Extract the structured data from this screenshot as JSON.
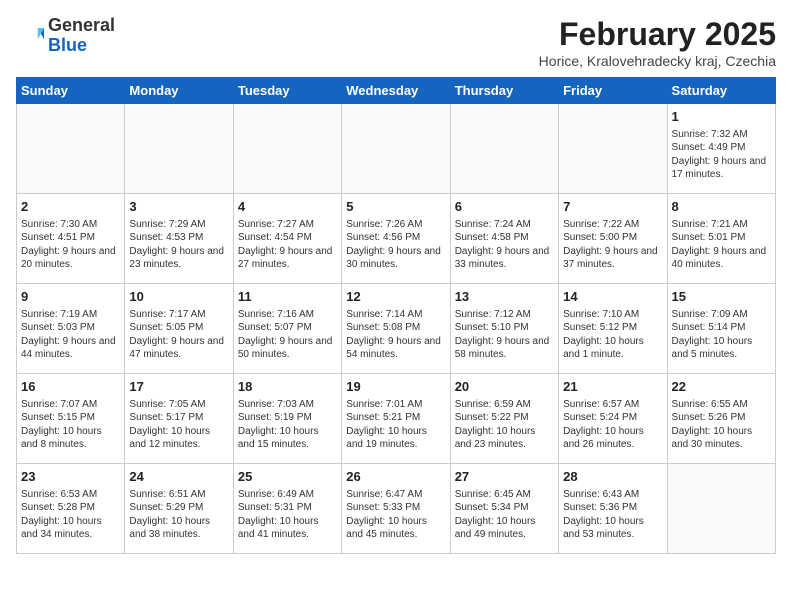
{
  "header": {
    "logo_general": "General",
    "logo_blue": "Blue",
    "title": "February 2025",
    "subtitle": "Horice, Kralovehradecky kraj, Czechia"
  },
  "weekdays": [
    "Sunday",
    "Monday",
    "Tuesday",
    "Wednesday",
    "Thursday",
    "Friday",
    "Saturday"
  ],
  "weeks": [
    [
      {
        "day": "",
        "info": ""
      },
      {
        "day": "",
        "info": ""
      },
      {
        "day": "",
        "info": ""
      },
      {
        "day": "",
        "info": ""
      },
      {
        "day": "",
        "info": ""
      },
      {
        "day": "",
        "info": ""
      },
      {
        "day": "1",
        "info": "Sunrise: 7:32 AM\nSunset: 4:49 PM\nDaylight: 9 hours and 17 minutes."
      }
    ],
    [
      {
        "day": "2",
        "info": "Sunrise: 7:30 AM\nSunset: 4:51 PM\nDaylight: 9 hours and 20 minutes."
      },
      {
        "day": "3",
        "info": "Sunrise: 7:29 AM\nSunset: 4:53 PM\nDaylight: 9 hours and 23 minutes."
      },
      {
        "day": "4",
        "info": "Sunrise: 7:27 AM\nSunset: 4:54 PM\nDaylight: 9 hours and 27 minutes."
      },
      {
        "day": "5",
        "info": "Sunrise: 7:26 AM\nSunset: 4:56 PM\nDaylight: 9 hours and 30 minutes."
      },
      {
        "day": "6",
        "info": "Sunrise: 7:24 AM\nSunset: 4:58 PM\nDaylight: 9 hours and 33 minutes."
      },
      {
        "day": "7",
        "info": "Sunrise: 7:22 AM\nSunset: 5:00 PM\nDaylight: 9 hours and 37 minutes."
      },
      {
        "day": "8",
        "info": "Sunrise: 7:21 AM\nSunset: 5:01 PM\nDaylight: 9 hours and 40 minutes."
      }
    ],
    [
      {
        "day": "9",
        "info": "Sunrise: 7:19 AM\nSunset: 5:03 PM\nDaylight: 9 hours and 44 minutes."
      },
      {
        "day": "10",
        "info": "Sunrise: 7:17 AM\nSunset: 5:05 PM\nDaylight: 9 hours and 47 minutes."
      },
      {
        "day": "11",
        "info": "Sunrise: 7:16 AM\nSunset: 5:07 PM\nDaylight: 9 hours and 50 minutes."
      },
      {
        "day": "12",
        "info": "Sunrise: 7:14 AM\nSunset: 5:08 PM\nDaylight: 9 hours and 54 minutes."
      },
      {
        "day": "13",
        "info": "Sunrise: 7:12 AM\nSunset: 5:10 PM\nDaylight: 9 hours and 58 minutes."
      },
      {
        "day": "14",
        "info": "Sunrise: 7:10 AM\nSunset: 5:12 PM\nDaylight: 10 hours and 1 minute."
      },
      {
        "day": "15",
        "info": "Sunrise: 7:09 AM\nSunset: 5:14 PM\nDaylight: 10 hours and 5 minutes."
      }
    ],
    [
      {
        "day": "16",
        "info": "Sunrise: 7:07 AM\nSunset: 5:15 PM\nDaylight: 10 hours and 8 minutes."
      },
      {
        "day": "17",
        "info": "Sunrise: 7:05 AM\nSunset: 5:17 PM\nDaylight: 10 hours and 12 minutes."
      },
      {
        "day": "18",
        "info": "Sunrise: 7:03 AM\nSunset: 5:19 PM\nDaylight: 10 hours and 15 minutes."
      },
      {
        "day": "19",
        "info": "Sunrise: 7:01 AM\nSunset: 5:21 PM\nDaylight: 10 hours and 19 minutes."
      },
      {
        "day": "20",
        "info": "Sunrise: 6:59 AM\nSunset: 5:22 PM\nDaylight: 10 hours and 23 minutes."
      },
      {
        "day": "21",
        "info": "Sunrise: 6:57 AM\nSunset: 5:24 PM\nDaylight: 10 hours and 26 minutes."
      },
      {
        "day": "22",
        "info": "Sunrise: 6:55 AM\nSunset: 5:26 PM\nDaylight: 10 hours and 30 minutes."
      }
    ],
    [
      {
        "day": "23",
        "info": "Sunrise: 6:53 AM\nSunset: 5:28 PM\nDaylight: 10 hours and 34 minutes."
      },
      {
        "day": "24",
        "info": "Sunrise: 6:51 AM\nSunset: 5:29 PM\nDaylight: 10 hours and 38 minutes."
      },
      {
        "day": "25",
        "info": "Sunrise: 6:49 AM\nSunset: 5:31 PM\nDaylight: 10 hours and 41 minutes."
      },
      {
        "day": "26",
        "info": "Sunrise: 6:47 AM\nSunset: 5:33 PM\nDaylight: 10 hours and 45 minutes."
      },
      {
        "day": "27",
        "info": "Sunrise: 6:45 AM\nSunset: 5:34 PM\nDaylight: 10 hours and 49 minutes."
      },
      {
        "day": "28",
        "info": "Sunrise: 6:43 AM\nSunset: 5:36 PM\nDaylight: 10 hours and 53 minutes."
      },
      {
        "day": "",
        "info": ""
      }
    ]
  ]
}
